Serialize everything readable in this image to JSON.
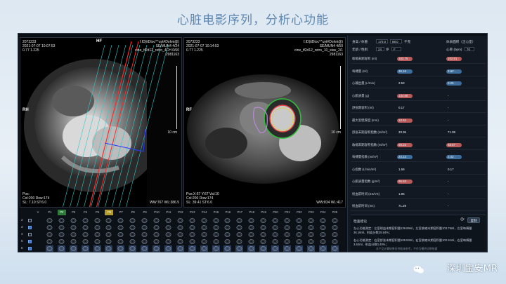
{
  "slide": {
    "title": "心脏电影序列，分析心功能"
  },
  "watermark": {
    "text": "深圳宝安MR",
    "icon": "wechat-icon"
  },
  "viewport1": {
    "info_top_left": [
      "2073233",
      "2021-07-07 10:07:53",
      "0.77 1.225"
    ],
    "info_top_right": [
      "f.ID(itDtoc^^uyt#Dohni@)",
      "SE/MUN4 4/24",
      "cine_tf2d12_retro_4CH 0/60",
      "2981163"
    ],
    "orientation": {
      "top": "HF",
      "left": "RH"
    },
    "scale": "10 cm",
    "info_bottom_left": [
      "Pos:",
      "Col:200 Row:174",
      "SL: 7.10 ST:6.0"
    ],
    "info_bottom_right": "WW:767 WL:386.5"
  },
  "viewport2": {
    "info_top_left": [
      "2073233",
      "2021-07-07 10:14:53",
      "0.77 1.225"
    ],
    "info_top_right": [
      "f.ID(itDtoc^^uyt#Dohni@)",
      "SE/MUN4 4/50",
      "cine_tf2d12_retro_10_stav_2/1",
      "2981163"
    ],
    "orientation": {
      "left": "RF"
    },
    "scale": "10 cm",
    "info_bottom_left": [
      "Pos:X:67 Y:67 Val:10",
      "Col:200 Row:174",
      "SL: 39.41 ST:6.0"
    ],
    "info_bottom_right": "WW:834 WL:417"
  },
  "patient": {
    "height_label": "身高 / 体重",
    "height": "170.0",
    "weight": "68.0",
    "weight_unit": "千克",
    "bsa_label": "体表面积（正心室）",
    "age_label": "年龄 / 性别",
    "age": "24",
    "age_unit": "岁",
    "sex": "F",
    "hr_label": "心率 (bpm)",
    "hr": "70"
  },
  "metrics": [
    {
      "label": "收缩末期容积 (ml)",
      "lv": "103.75",
      "lv_flag": "hi",
      "lv_arrow": "up",
      "rv": "102.91",
      "rv_flag": "hi",
      "rv_arrow": "up"
    },
    {
      "label": "每搏量 (ml)",
      "lv": "36.16",
      "lv_flag": "lo",
      "lv_arrow": "dn",
      "rv": "3.62",
      "rv_flag": "lo",
      "rv_arrow": "dn"
    },
    {
      "label": "心输出量 (L/min)",
      "lv": "2.53",
      "lv_flag": "plain",
      "lv_arrow": "",
      "rv": "0.25",
      "rv_flag": "lo",
      "rv_arrow": "dn"
    },
    {
      "label": "心肌质量 (g)",
      "lv": "144.66",
      "lv_flag": "hi",
      "lv_arrow": "up",
      "rv": "-",
      "rv_flag": "plain",
      "rv_arrow": ""
    },
    {
      "label": "舒张期容积 (ml)",
      "lv": "0.17",
      "lv_flag": "plain",
      "lv_arrow": "",
      "rv": "-",
      "rv_flag": "plain",
      "rv_arrow": ""
    },
    {
      "label": "最大室壁厚度 (mm)",
      "lv": "10.62",
      "lv_flag": "hi",
      "lv_arrow": "",
      "rv": "-",
      "rv_flag": "plain",
      "rv_arrow": ""
    },
    {
      "label": "舒张末期容积指数 (ml/m²)",
      "lv": "33.36",
      "lv_flag": "plain",
      "lv_arrow": "",
      "rv": "71.09",
      "rv_flag": "plain",
      "rv_arrow": ""
    },
    {
      "label": "收缩末期容积指数 (ml/m²)",
      "lv": "69.23",
      "lv_flag": "hi",
      "lv_arrow": "up",
      "rv": "68.67",
      "rv_flag": "hi",
      "rv_arrow": "up"
    },
    {
      "label": "每搏量指数 (ml/m²)",
      "lv": "24.13",
      "lv_flag": "lo",
      "lv_arrow": "dn",
      "rv": "2.42",
      "rv_flag": "lo",
      "rv_arrow": "dn"
    },
    {
      "label": "心指数 (L/min/m²)",
      "lv": "1.69",
      "lv_flag": "plain",
      "lv_arrow": "",
      "rv": "0.17",
      "rv_flag": "plain",
      "rv_arrow": ""
    },
    {
      "label": "心肌质量指数 (g/m²)",
      "lv": "96.53",
      "lv_flag": "hi",
      "lv_arrow": "up",
      "rv": "-",
      "rv_flag": "plain",
      "rv_arrow": ""
    },
    {
      "label": "射血前时间 (ES/VS)",
      "lv": "1.96",
      "lv_flag": "plain",
      "lv_arrow": "",
      "rv": "-",
      "rv_flag": "plain",
      "rv_arrow": ""
    },
    {
      "label": "射血前时间 (ms)",
      "lv": "71.29",
      "lv_flag": "plain",
      "lv_arrow": "",
      "rv": "-",
      "rv_flag": "plain",
      "rv_arrow": ""
    }
  ],
  "conclusion": {
    "title": "检查结论",
    "button": "复制",
    "lv_text": "左心功能测定：左室射血末期容积量139.89ml，左室收缩末期容积量103.75ml，左室每搏量36.16ml，射血分数25.84%；",
    "rv_text": "右心功能测定：右室舒张末期容积量106.53ml，右室收缩末期容积量102.91ml，右室每搏量3.62ml，射血分数3.40%；",
    "footnote": "本产品计算结果仅供临床参考，不作为最终诊断依据"
  },
  "grid": {
    "columns": [
      "V",
      "P1",
      "P2",
      "P3",
      "P4",
      "P5",
      "P6",
      "P7",
      "P8",
      "P9",
      "P10",
      "P11",
      "P12",
      "P13",
      "P14",
      "P15",
      "P16",
      "P17",
      "P18",
      "P19",
      "P20",
      "P21",
      "P22",
      "P23",
      "P24",
      "P25"
    ],
    "selected_column": "P2",
    "highlight_column": "P6",
    "rows": [
      {
        "label": "2",
        "checked": false
      },
      {
        "label": "3",
        "checked": true
      },
      {
        "label": "4",
        "checked": false
      },
      {
        "label": "5",
        "checked": true
      },
      {
        "label": "6",
        "checked": true
      }
    ]
  },
  "colors": {
    "accent": "#3b74c5",
    "high": "#b65a5a",
    "low": "#3e6d9b",
    "selected": "#2f7a3a"
  }
}
